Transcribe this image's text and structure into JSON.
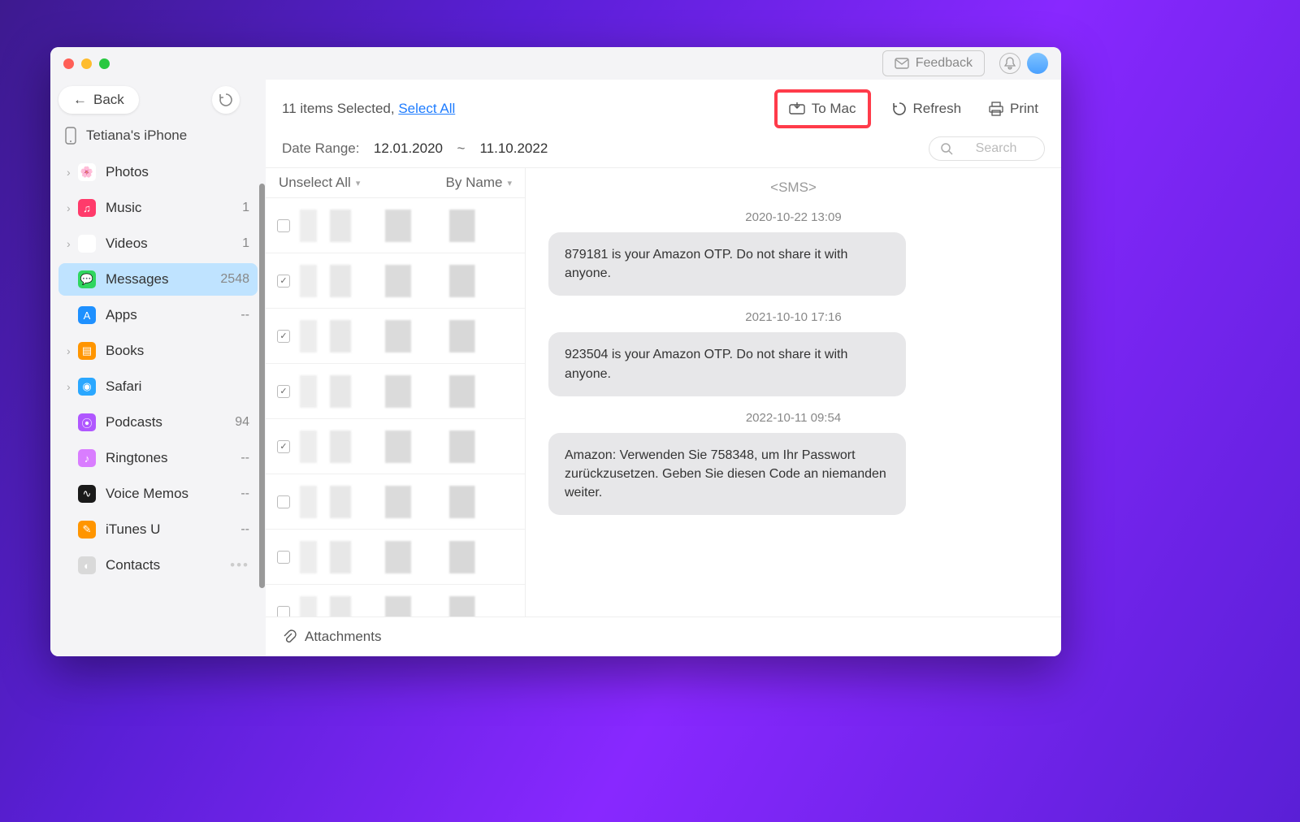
{
  "titlebar": {
    "feedback": "Feedback"
  },
  "sidebar": {
    "back": "Back",
    "device": "Tetiana's iPhone",
    "items": [
      {
        "label": "Photos",
        "count": "",
        "expandable": true,
        "icon": "photos",
        "color": "#fff"
      },
      {
        "label": "Music",
        "count": "1",
        "expandable": true,
        "icon": "music",
        "color": "#ff3b6b"
      },
      {
        "label": "Videos",
        "count": "1",
        "expandable": true,
        "icon": "videos",
        "color": "#fff"
      },
      {
        "label": "Messages",
        "count": "2548",
        "expandable": false,
        "icon": "messages",
        "color": "#2fd65f",
        "selected": true
      },
      {
        "label": "Apps",
        "count": "--",
        "expandable": false,
        "icon": "apps",
        "color": "#1e90ff"
      },
      {
        "label": "Books",
        "count": "",
        "expandable": true,
        "icon": "books",
        "color": "#ff9500"
      },
      {
        "label": "Safari",
        "count": "",
        "expandable": true,
        "icon": "safari",
        "color": "#2aa7ff"
      },
      {
        "label": "Podcasts",
        "count": "94",
        "expandable": false,
        "icon": "podcasts",
        "color": "#b057ff"
      },
      {
        "label": "Ringtones",
        "count": "--",
        "expandable": false,
        "icon": "ringtones",
        "color": "#d97dff"
      },
      {
        "label": "Voice Memos",
        "count": "--",
        "expandable": false,
        "icon": "voicememo",
        "color": "#1a1a1a"
      },
      {
        "label": "iTunes U",
        "count": "--",
        "expandable": false,
        "icon": "itunesu",
        "color": "#ff9500"
      },
      {
        "label": "Contacts",
        "count": "",
        "expandable": false,
        "icon": "contacts",
        "color": "#d9d9d9",
        "dots": true
      }
    ]
  },
  "toolbar": {
    "selected_text": "11 items Selected, ",
    "select_all": "Select All",
    "to_mac": "To Mac",
    "refresh": "Refresh",
    "print": "Print"
  },
  "filter": {
    "label": "Date Range:",
    "from": "12.01.2020",
    "sep": "~",
    "to": "11.10.2022",
    "search_placeholder": "Search"
  },
  "list": {
    "unselect_all": "Unselect All",
    "sort": "By Name",
    "rows": [
      {
        "checked": false
      },
      {
        "checked": true
      },
      {
        "checked": true
      },
      {
        "checked": true
      },
      {
        "checked": true
      },
      {
        "checked": false
      },
      {
        "checked": false
      },
      {
        "checked": false
      }
    ]
  },
  "detail": {
    "header": "<SMS>",
    "thread": [
      {
        "ts": "2020-10-22 13:09",
        "text": "879181 is your Amazon OTP. Do not share it with anyone."
      },
      {
        "ts": "2021-10-10 17:16",
        "text": "923504 is your Amazon OTP. Do not share it with anyone."
      },
      {
        "ts": "2022-10-11 09:54",
        "text": "Amazon: Verwenden Sie 758348, um Ihr Passwort zurückzusetzen. Geben Sie diesen Code an niemanden weiter."
      }
    ]
  },
  "attachments": "Attachments"
}
